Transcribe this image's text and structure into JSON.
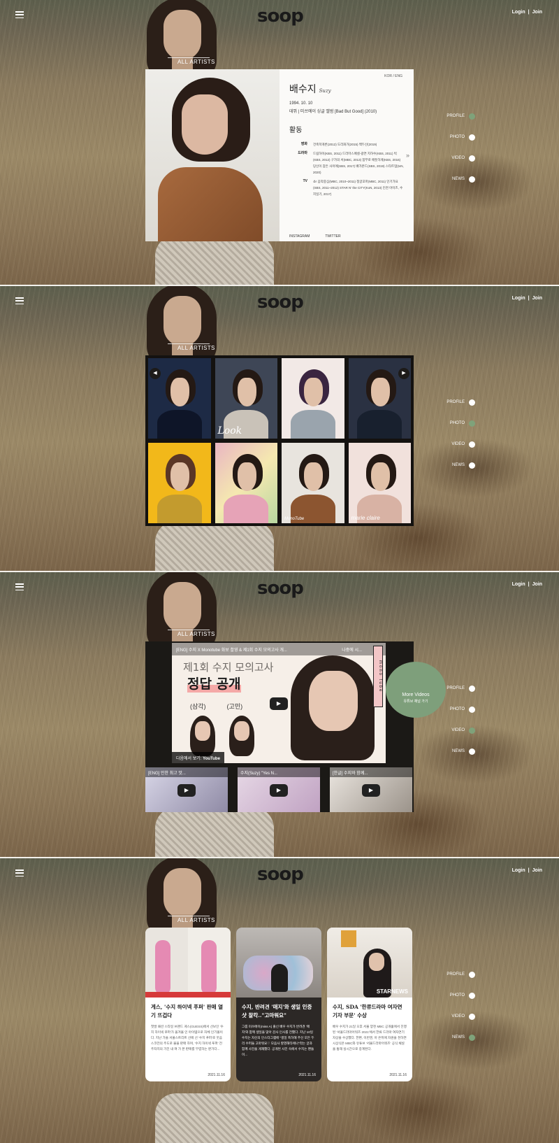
{
  "header": {
    "logo": "soop",
    "login": "Login",
    "sep": "|",
    "join": "Join",
    "menu_icon": "hamburger-icon"
  },
  "section_label": "ALL ARTISTS",
  "side_nav": [
    "PROFILE",
    "PHOTO",
    "VIDEO",
    "NEWS"
  ],
  "profile": {
    "lang_kor": "KOR",
    "lang_sep": "/",
    "lang_eng": "ENG",
    "name": "배수지",
    "name_en": "Suzy",
    "birth": "1994. 10. 10",
    "debut": "데뷔 | 미쓰에이 싱글 앨범 [Bad But Good] (2010)",
    "activity_title": "활동",
    "rows": [
      {
        "label": "영화",
        "text": "건축학개론(2012) 도리화가(2015) 백두산(2019)"
      },
      {
        "label": "드라마",
        "text": "드림하이(KBS, 2011) 드라마스페셜-광연 지하수(KBS, 2011) 빅(KBS, 2012) 구가의 서(MBC, 2013) 함부로 애틋하게(KBS, 2016) 당신이 잠든 사이에(SBS, 2017) 배가본드(SBS, 2019) 스타트업(tvN, 2020)"
      },
      {
        "label": "TV",
        "text": "쇼! 음악중심(MBC, 2010~2011) 정글꼬마(MBC, 2011) 인기가요(SBS, 2011~2012) STAR N' the CITY(KoN, 2013) 인천 아이즈, 수지일기, 2017)"
      }
    ],
    "instagram": "INSTAGRAM",
    "twitter": "TWITTER",
    "next_arrow": "»"
  },
  "photos": {
    "captions": [
      "",
      "Look",
      "",
      "",
      "",
      "",
      "MonoTube",
      "marie claire"
    ],
    "prev": "◀",
    "next": "▶"
  },
  "video": {
    "main_title": "[ENG] 수지 X Monotube 화보 촬영 & 제1회 수지 모의고사 개...",
    "watch_later": "나중에 시...",
    "headline1": "제1회 수지 모의고사",
    "headline2": "정답 공개",
    "tag1": "(삼각)",
    "tag2": "(고민)",
    "watch_on": "다음에서 보기:",
    "youtube": "YouTube",
    "mono_label": "mono tube",
    "thumbs": [
      "[ENG] 인한 최고 맛...",
      "수지(Suzy) \"Yes N...",
      "[한글] 수지와 함께..."
    ],
    "more_title": "More Videos",
    "more_sub": "유튜브 채널 가기"
  },
  "news": [
    {
      "title": "게스, '수지 하이넥 푸퍼' 판매 열기 뜨겁다",
      "body": "첫발 패션 스타일 브랜드 게스(GUESS)에서 선보인 '수지 하이넥 푸퍼'가 올겨울 인 아이템으로 자체 인기몰이다. 지난 가을 서울스트리트 선에 선 '수지 푸퍼'로 웃음 스코전의 주도로 불을 판매 하며, '수지 하이넥 푸퍼' 전 주자지의 가진 내 여 가 본 판매를 부렴하는 판가다...",
      "date": "2021.11.16"
    },
    {
      "title": "수지, 반려견 '매지'와 생일 인증샷 찰칵..\"고마워요\"",
      "body": "그룹 미쓰에이(miss A) 출신 배우 수지가 반려견 '매지'와 함께 생일을 맞아 감사 인사를 전했다. 지난 10일 수지는 자신의 인스타그램에 \"생일 축하해 주신 모든 두리 수퍼들 고마워요♡ 모음사 할영해타에나\"라는 글과 함께 사진을 게재했다. 공개된 사진 속에서 수지는 팬들이...",
      "date": "2021.11.16"
    },
    {
      "title": "수지, SDA '한류드라마 여자연기자 부문' 수상",
      "body": "배우 수지가 21일 오후 서울 양천 MBC 공개홀에서 진행된 '서울드라마어워즈 2021'에서 한류 드라마 여자연기자상을 수상했다. 한편, 이번엔, 아 은뒤에 자원을 천하면 시상식은 MBC와 유튜브 '서울드라마어워즈' 공식 채널을 통해 실시간으로 중계된다.",
      "date": "2021.11.16",
      "watermark": "STARNEWS"
    }
  ]
}
